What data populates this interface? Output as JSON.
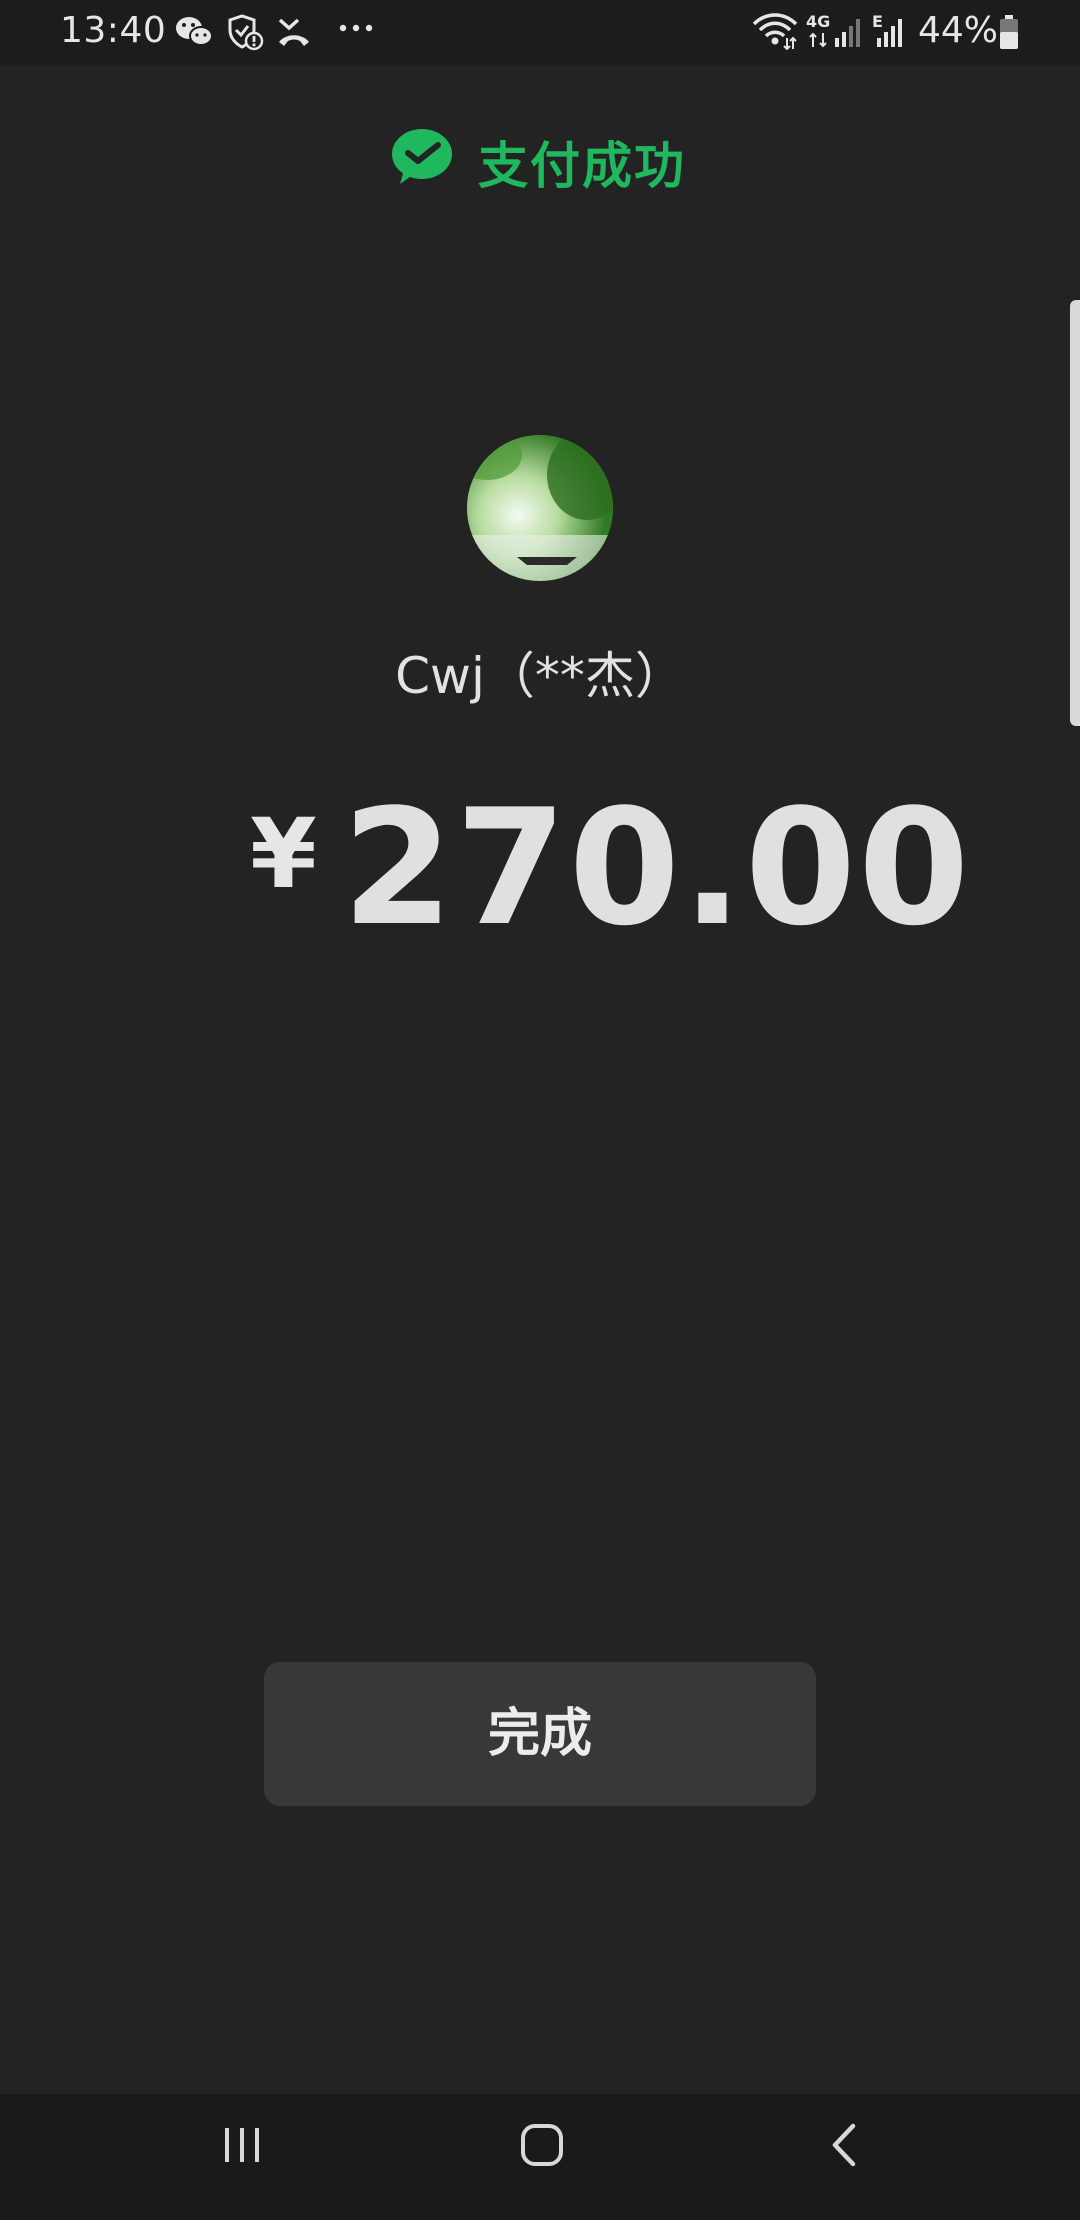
{
  "status_bar": {
    "time": "13:40",
    "battery_percent": "44%",
    "network_4g": "4G",
    "network_e": "E",
    "icons": [
      "wechat-icon",
      "shield-icon",
      "missed-call-icon",
      "more-dots-icon",
      "wifi-icon",
      "signal-icon",
      "battery-icon"
    ]
  },
  "header": {
    "title": "支付成功",
    "icon": "wechat-pay-icon",
    "accent_color": "#1fb85e"
  },
  "payee": {
    "name": "Cwj（**杰）"
  },
  "payment": {
    "currency_symbol": "¥",
    "amount": "270.00"
  },
  "done_button": {
    "label": "完成"
  },
  "nav_bar": {
    "icons": [
      "recents-icon",
      "home-icon",
      "back-icon"
    ]
  }
}
